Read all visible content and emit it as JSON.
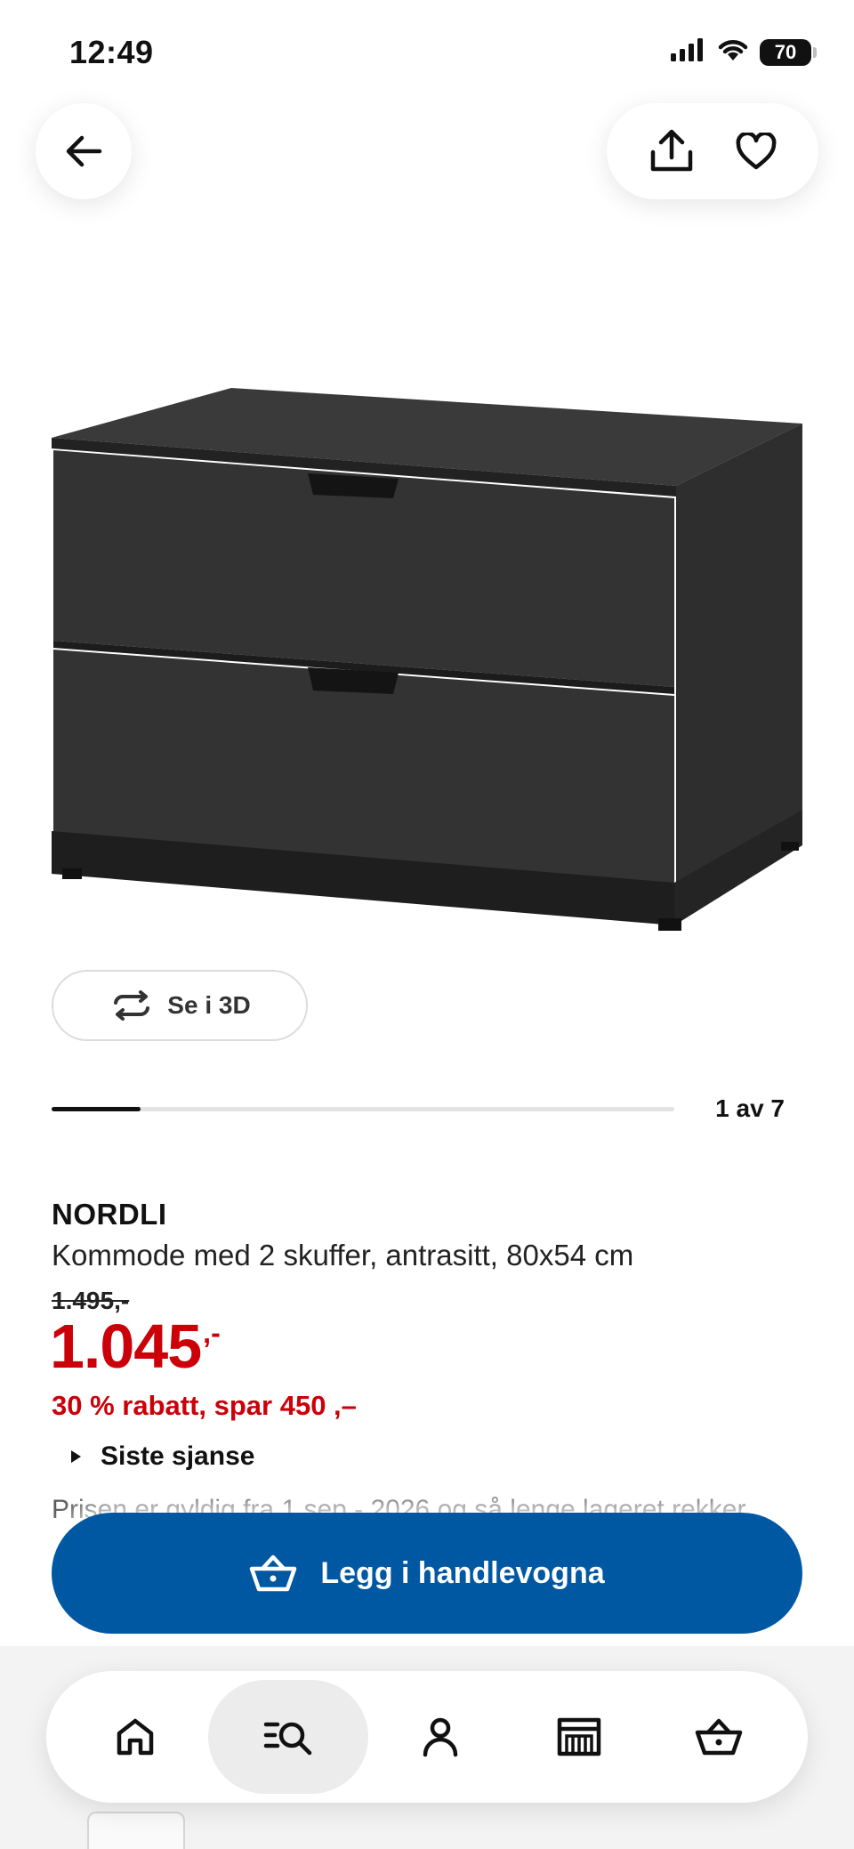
{
  "status_bar": {
    "time": "12:49",
    "battery": "70"
  },
  "header": {
    "back_icon": "arrow-left-icon",
    "share_icon": "share-icon",
    "favorite_icon": "heart-icon"
  },
  "gallery": {
    "view_3d_label": "Se i 3D",
    "counter": "1 av 7",
    "current_image": 1,
    "total_images": 7
  },
  "product": {
    "name": "NORDLI",
    "description": "Kommode med 2 skuffer, antrasitt, 80x54 cm",
    "old_price": "1.495,-",
    "price": "1.045",
    "price_suffix": ",-",
    "discount": "30 % rabatt, spar 450 ,–",
    "last_chance": "Siste sjanse",
    "validity": "Prisen er gyldig fra 1 sep - 2026 og så lenge lageret rekker"
  },
  "cart_button": {
    "label": "Legg i handlevogna"
  },
  "tab_bar": {
    "items": [
      {
        "icon": "home-icon",
        "active": false
      },
      {
        "icon": "search-list-icon",
        "active": true
      },
      {
        "icon": "profile-icon",
        "active": false
      },
      {
        "icon": "store-icon",
        "active": false
      },
      {
        "icon": "basket-icon",
        "active": false
      }
    ]
  },
  "colors": {
    "accent_blue": "#0058a3",
    "sale_red": "#cc0008"
  }
}
